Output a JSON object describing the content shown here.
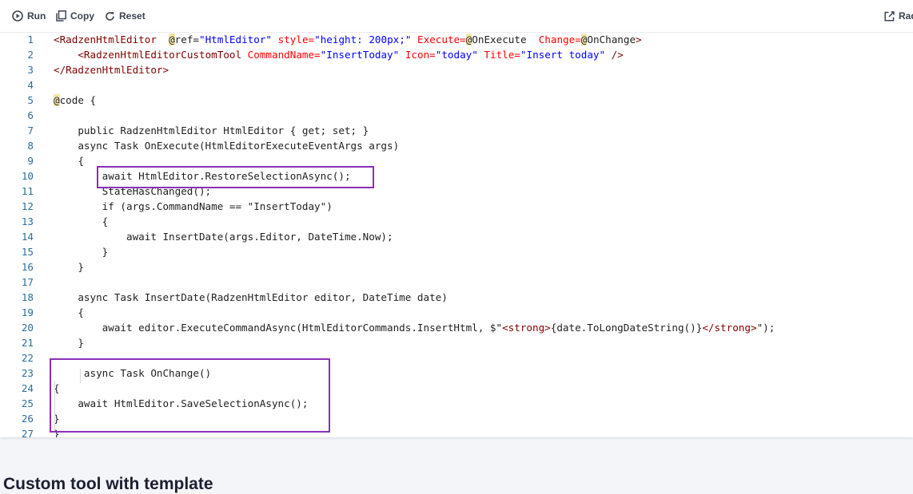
{
  "toolbar": {
    "run_label": "Run",
    "copy_label": "Copy",
    "reset_label": "Reset",
    "open_label": "Rad"
  },
  "editor": {
    "lines": [
      {
        "n": "1",
        "text": "<RadzenHtmlEditor  @ref=\"HtmlEditor\" style=\"height: 200px;\" Execute=@OnExecute  Change=@OnChange>"
      },
      {
        "n": "2",
        "text": "    <RadzenHtmlEditorCustomTool CommandName=\"InsertToday\" Icon=\"today\" Title=\"Insert today\" />"
      },
      {
        "n": "3",
        "text": "</RadzenHtmlEditor>"
      },
      {
        "n": "4",
        "text": ""
      },
      {
        "n": "5",
        "text": "@code {"
      },
      {
        "n": "6",
        "text": ""
      },
      {
        "n": "7",
        "text": "    public RadzenHtmlEditor HtmlEditor { get; set; }"
      },
      {
        "n": "8",
        "text": "    async Task OnExecute(HtmlEditorExecuteEventArgs args)"
      },
      {
        "n": "9",
        "text": "    {"
      },
      {
        "n": "10",
        "text": "        await HtmlEditor.RestoreSelectionAsync();"
      },
      {
        "n": "11",
        "text": "        StateHasChanged();"
      },
      {
        "n": "12",
        "text": "        if (args.CommandName == \"InsertToday\")"
      },
      {
        "n": "13",
        "text": "        {"
      },
      {
        "n": "14",
        "text": "            await InsertDate(args.Editor, DateTime.Now);"
      },
      {
        "n": "15",
        "text": "        }"
      },
      {
        "n": "16",
        "text": "    }"
      },
      {
        "n": "17",
        "text": ""
      },
      {
        "n": "18",
        "text": "    async Task InsertDate(RadzenHtmlEditor editor, DateTime date)"
      },
      {
        "n": "19",
        "text": "    {"
      },
      {
        "n": "20",
        "text": "        await editor.ExecuteCommandAsync(HtmlEditorCommands.InsertHtml, $\"<strong>{date.ToLongDateString()}</strong>\");"
      },
      {
        "n": "21",
        "text": "    }"
      },
      {
        "n": "22",
        "text": ""
      },
      {
        "n": "23",
        "text": "     async Task OnChange()"
      },
      {
        "n": "24",
        "text": "{"
      },
      {
        "n": "25",
        "text": "    await HtmlEditor.SaveSelectionAsync();"
      },
      {
        "n": "26",
        "text": "}"
      },
      {
        "n": "27",
        "text": "}"
      }
    ]
  },
  "section_title": "Custom tool with template",
  "colors": {
    "highlight_box": "#8b2fb8",
    "line_number": "#2b6f9e",
    "markup_tag": "#800000",
    "attribute": "#ff0000",
    "string": "#0000ff"
  }
}
